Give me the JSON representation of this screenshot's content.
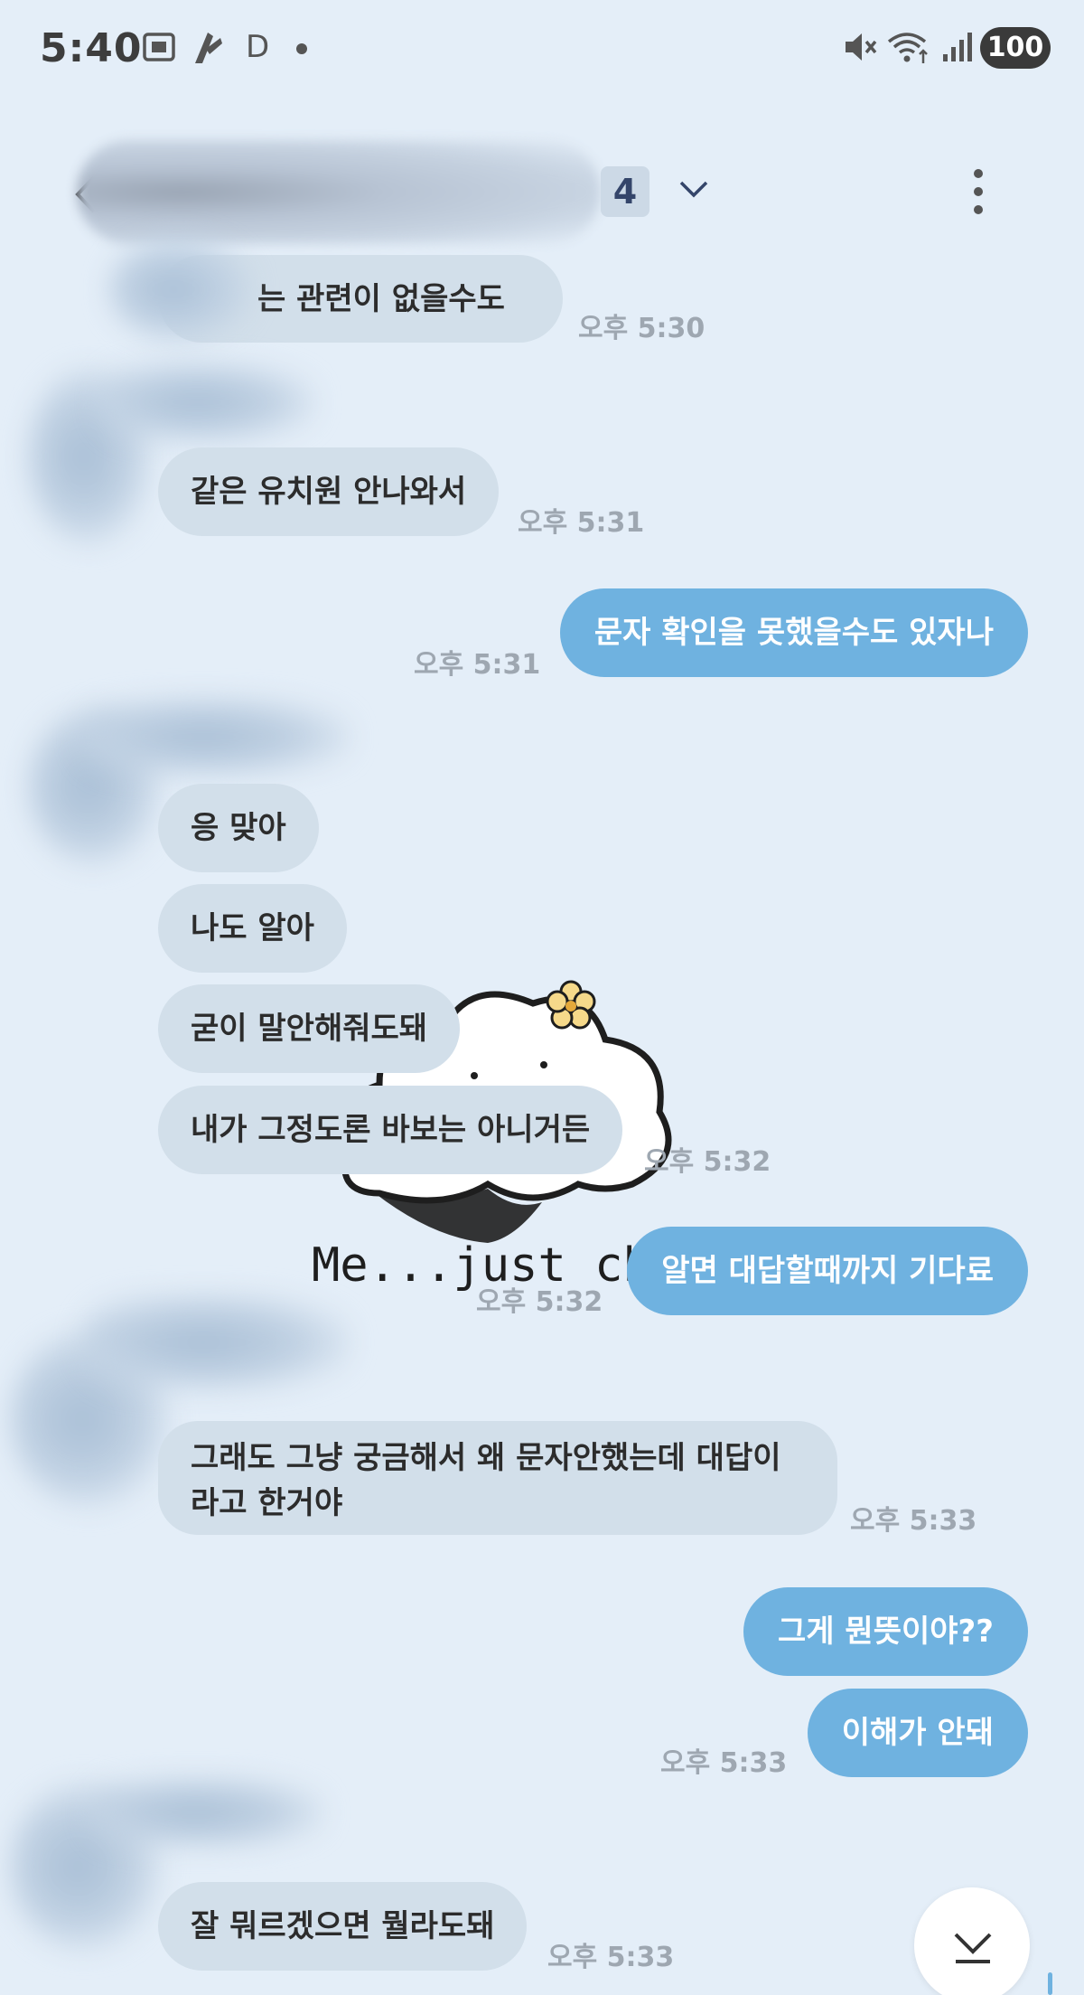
{
  "status_bar": {
    "time": "5:40",
    "letter": "D",
    "battery": "100"
  },
  "header": {
    "member_count": "4"
  },
  "messages": [
    {
      "side": "in",
      "text": "는 관련이 없을수도",
      "time": "오후 5:30"
    },
    {
      "side": "in",
      "text": "같은 유치원 안나와서",
      "time": "오후 5:31"
    },
    {
      "side": "out",
      "text": "문자 확인을 못했을수도 있자나",
      "time": "오후 5:31"
    },
    {
      "side": "in",
      "text": "응 맞아"
    },
    {
      "side": "in",
      "text": "나도 알아"
    },
    {
      "side": "in",
      "text": "굳이 말안해줘도돼"
    },
    {
      "side": "in",
      "text": "내가 그정도론 바보는 아니거든",
      "time": "오후 5:32"
    },
    {
      "side": "out",
      "text": "알면 대답할때까지 기다료",
      "time": "오후 5:32"
    },
    {
      "side": "in",
      "text": "그래도 그냥 궁금해서 왜 문자안했는데 대답이라고 한거야",
      "time": "오후 5:33"
    },
    {
      "side": "out",
      "text": "그게 뭔뜻이야??"
    },
    {
      "side": "out",
      "text": "이해가 안돼",
      "time": "오후 5:33"
    },
    {
      "side": "in",
      "text": "잘 뭐르겠으면 뭘라도돼",
      "time": "오후 5:33"
    }
  ],
  "sticker": {
    "caption": "Me...just chil"
  },
  "colors": {
    "background": "#e4eef8",
    "incoming_bubble": "#d2dfea",
    "outgoing_bubble": "#6fb2e0",
    "timestamp": "#9ea7b1"
  },
  "icons": [
    "screenshot-icon",
    "app-icon",
    "back-icon",
    "chevron-down-icon",
    "more-vertical-icon",
    "mute-icon",
    "wifi-icon",
    "signal-icon",
    "scroll-down-icon"
  ]
}
